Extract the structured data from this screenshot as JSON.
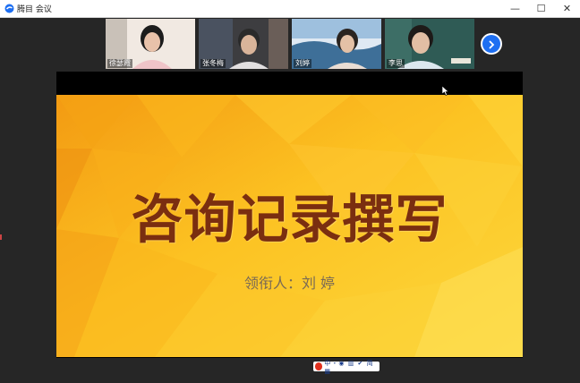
{
  "app": {
    "title": "腾目 会议"
  },
  "window_controls": {
    "minimize": "—",
    "maximize": "☐",
    "close": "✕"
  },
  "participants": [
    {
      "name": "徐瑟霞",
      "active": false
    },
    {
      "name": "张冬梅",
      "active": false
    },
    {
      "name": "刘婷",
      "active": true
    },
    {
      "name": "李思",
      "active": false
    }
  ],
  "slide": {
    "title": "咨询记录撰写",
    "presenter": "领衔人：刘 婷",
    "bg_colors": [
      "#fbc21e",
      "#f09a14",
      "#fde25a"
    ]
  },
  "ime": {
    "text": "中・◉ ▥ ✔ 简 ▦"
  },
  "colors": {
    "accent": "#1e6ff2",
    "active_border": "#f3c200",
    "title_text": "#7a2e10"
  }
}
